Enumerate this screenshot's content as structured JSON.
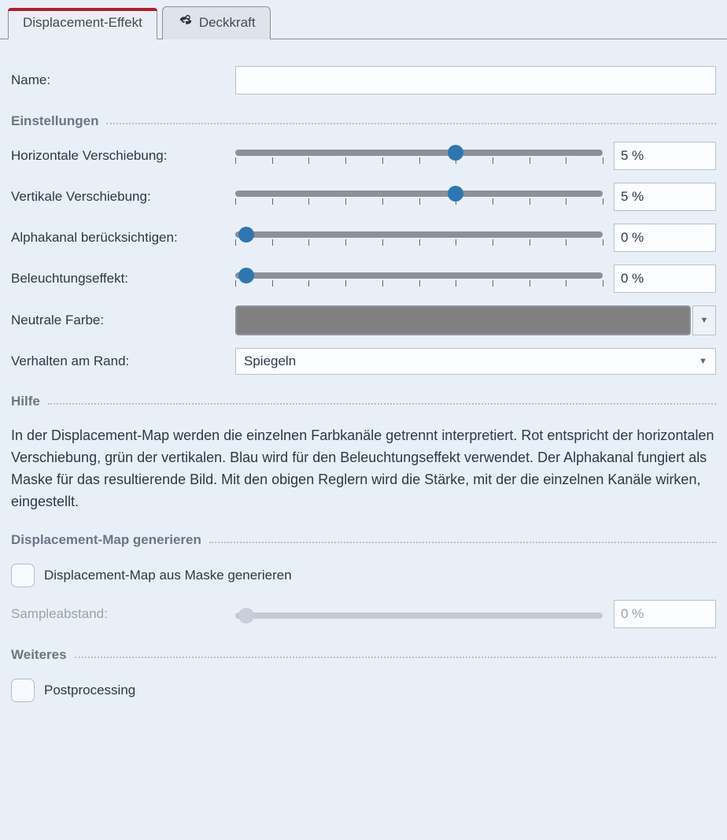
{
  "tabs": {
    "displacement": "Displacement-Effekt",
    "opacity": "Deckkraft"
  },
  "name": {
    "label": "Name:",
    "value": ""
  },
  "sections": {
    "settings": "Einstellungen",
    "help": "Hilfe",
    "generate": "Displacement-Map generieren",
    "more": "Weiteres"
  },
  "sliders": {
    "hshift": {
      "label": "Horizontale Verschiebung:",
      "value": "5 %",
      "percent": 60,
      "disabled": false
    },
    "vshift": {
      "label": "Vertikale Verschiebung:",
      "value": "5 %",
      "percent": 60,
      "disabled": false
    },
    "alpha": {
      "label": "Alphakanal berücksichtigen:",
      "value": "0 %",
      "percent": 3,
      "disabled": false
    },
    "light": {
      "label": "Beleuchtungseffekt:",
      "value": "0 %",
      "percent": 3,
      "disabled": false
    },
    "sample": {
      "label": "Sampleabstand:",
      "value": "0 %",
      "percent": 3,
      "disabled": true
    }
  },
  "color": {
    "label": "Neutrale Farbe:",
    "hex": "#808080"
  },
  "edge": {
    "label": "Verhalten am Rand:",
    "value": "Spiegeln"
  },
  "help_text": "In der Displacement-Map werden die einzelnen Farbkanäle getrennt interpretiert. Rot entspricht der horizontalen Verschiebung, grün der vertikalen. Blau wird für den Beleuchtungseffekt verwendet. Der Alphakanal fungiert als Maske für das resultierende Bild. Mit den obigen Reglern wird die Stärke, mit der die einzelnen Kanäle wirken, eingestellt.",
  "checks": {
    "genfrommask": "Displacement-Map aus Maske generieren",
    "postprocess": "Postprocessing"
  }
}
